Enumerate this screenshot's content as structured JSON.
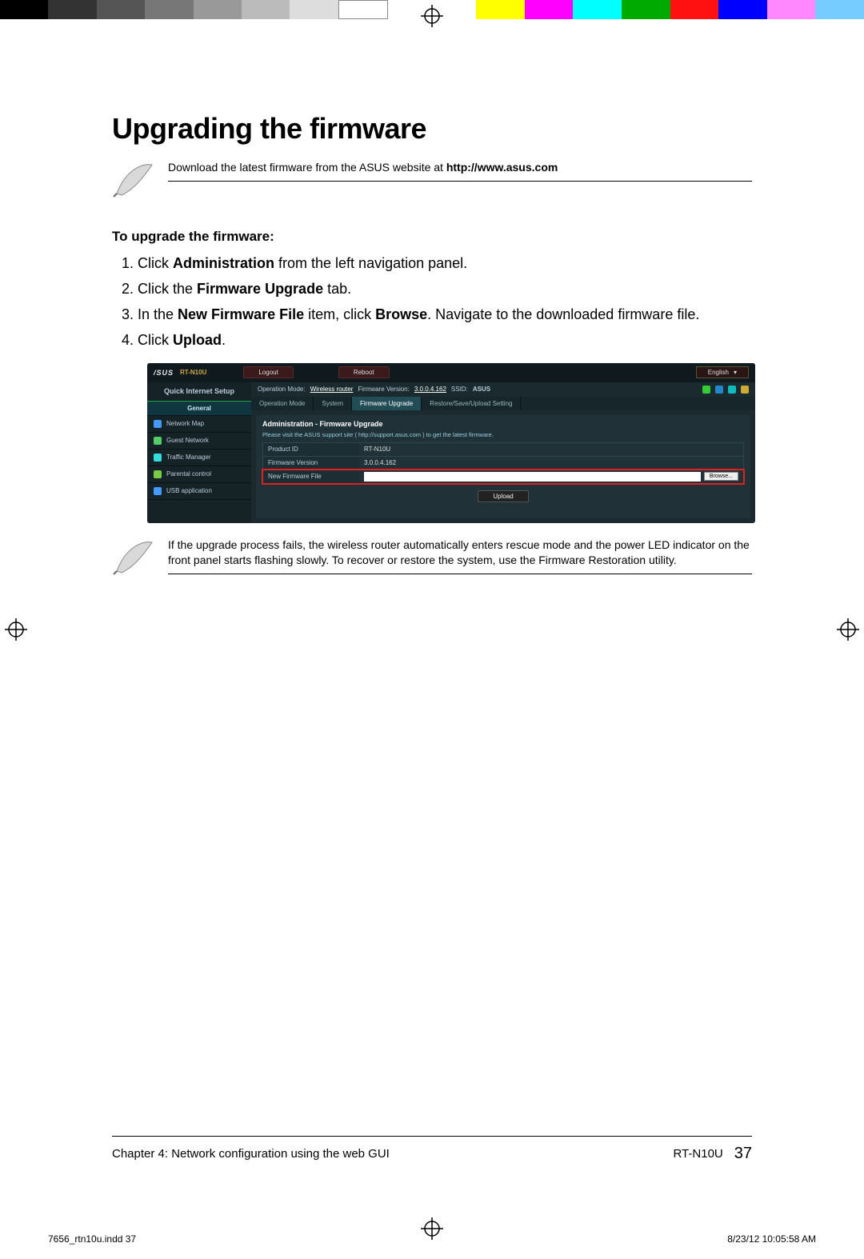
{
  "doc": {
    "title": "Upgrading the firmware",
    "note1_prefix": "Download the latest firmware from the ASUS website at ",
    "note1_link": "http://www.asus.com",
    "steps_head": "To upgrade the firmware:",
    "steps": {
      "s1a": "Click ",
      "s1b": "Administration",
      "s1c": " from the left navigation panel.",
      "s2a": "Click the ",
      "s2b": "Firmware Upgrade",
      "s2c": " tab.",
      "s3a": "In the ",
      "s3b": "New Firmware File",
      "s3c": " item, click ",
      "s3d": "Browse",
      "s3e": ". Navigate to the downloaded firmware file.",
      "s4a": "Click ",
      "s4b": "Upload",
      "s4c": "."
    },
    "note2": "If the upgrade process fails, the wireless router automatically enters rescue mode and the power LED indicator on the front panel starts flashing slowly. To recover or restore the system, use the Firmware Restoration utility.",
    "footer_chapter": "Chapter 4: Network configuration using the web GUI",
    "footer_model": "RT-N10U",
    "footer_page": "37",
    "slug_file": "7656_rtn10u.indd   37",
    "slug_date": "8/23/12   10:05:58 AM"
  },
  "router": {
    "logo": "/SUS",
    "model": "RT-N10U",
    "btn_logout": "Logout",
    "btn_reboot": "Reboot",
    "lang": "English",
    "info": {
      "opmode_lbl": "Operation Mode:",
      "opmode_val": "Wireless router",
      "fw_lbl": "Firmware Version:",
      "fw_val": "3.0.0.4.162",
      "ssid_lbl": "SSID:",
      "ssid_val": "ASUS"
    },
    "side": {
      "qis": "Quick Internet Setup",
      "cat": "General",
      "items": [
        "Network Map",
        "Guest Network",
        "Traffic Manager",
        "Parental control",
        "USB application"
      ]
    },
    "tabs": [
      "Operation Mode",
      "System",
      "Firmware Upgrade",
      "Restore/Save/Upload Setting"
    ],
    "panel": {
      "title": "Administration - Firmware Upgrade",
      "hint": "Please visit the ASUS support site ( http://support.asus.com ) to get the latest firmware.",
      "rows": {
        "pid_lbl": "Product ID",
        "pid_val": "RT-N10U",
        "fw_lbl": "Firmware Version",
        "fw_val": "3.0.0.4.162",
        "nf_lbl": "New Firmware File",
        "browse": "Browse..."
      },
      "upload": "Upload"
    }
  }
}
